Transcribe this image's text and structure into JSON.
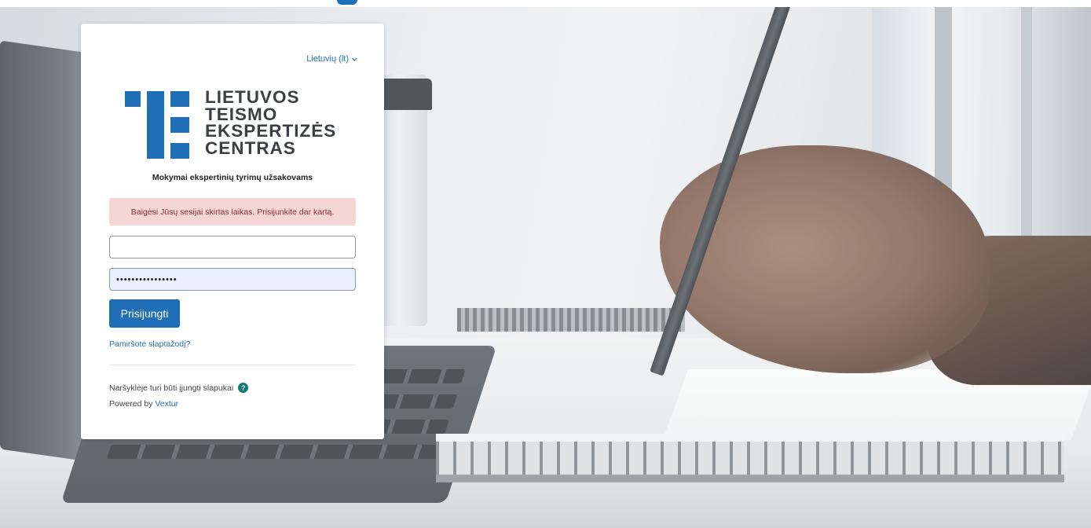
{
  "language": {
    "label": "Lietuvių (lt)",
    "icon": "chevron-down-icon"
  },
  "logo": {
    "lines": [
      "LIETUVOS",
      "TEISMO",
      "EKSPERTIZĖS",
      "CENTRAS"
    ],
    "mark_color": "#1f6fb8",
    "text_color": "#3a3f44"
  },
  "subtitle": "Mokymai ekspertinių tyrimų užsakovams",
  "alert": {
    "text": "Baigėsi Jūsų sesijai skirtas laikas. Prisijunkite dar kartą.",
    "color": "#f6d5d5"
  },
  "form": {
    "username": {
      "value": "",
      "placeholder": ""
    },
    "password": {
      "value": "••••••••••••••••",
      "placeholder": ""
    },
    "submit_label": "Prisijungti",
    "forgot_label": "Pamiršote slaptažodį?"
  },
  "footer": {
    "cookies_text": "Naršyklėje turi būti įjungti slapukai",
    "help_icon": "question-icon",
    "powered_prefix": "Powered by",
    "powered_link": "Vextur"
  },
  "colors": {
    "accent": "#1f6fb8",
    "help": "#0f7a76"
  }
}
